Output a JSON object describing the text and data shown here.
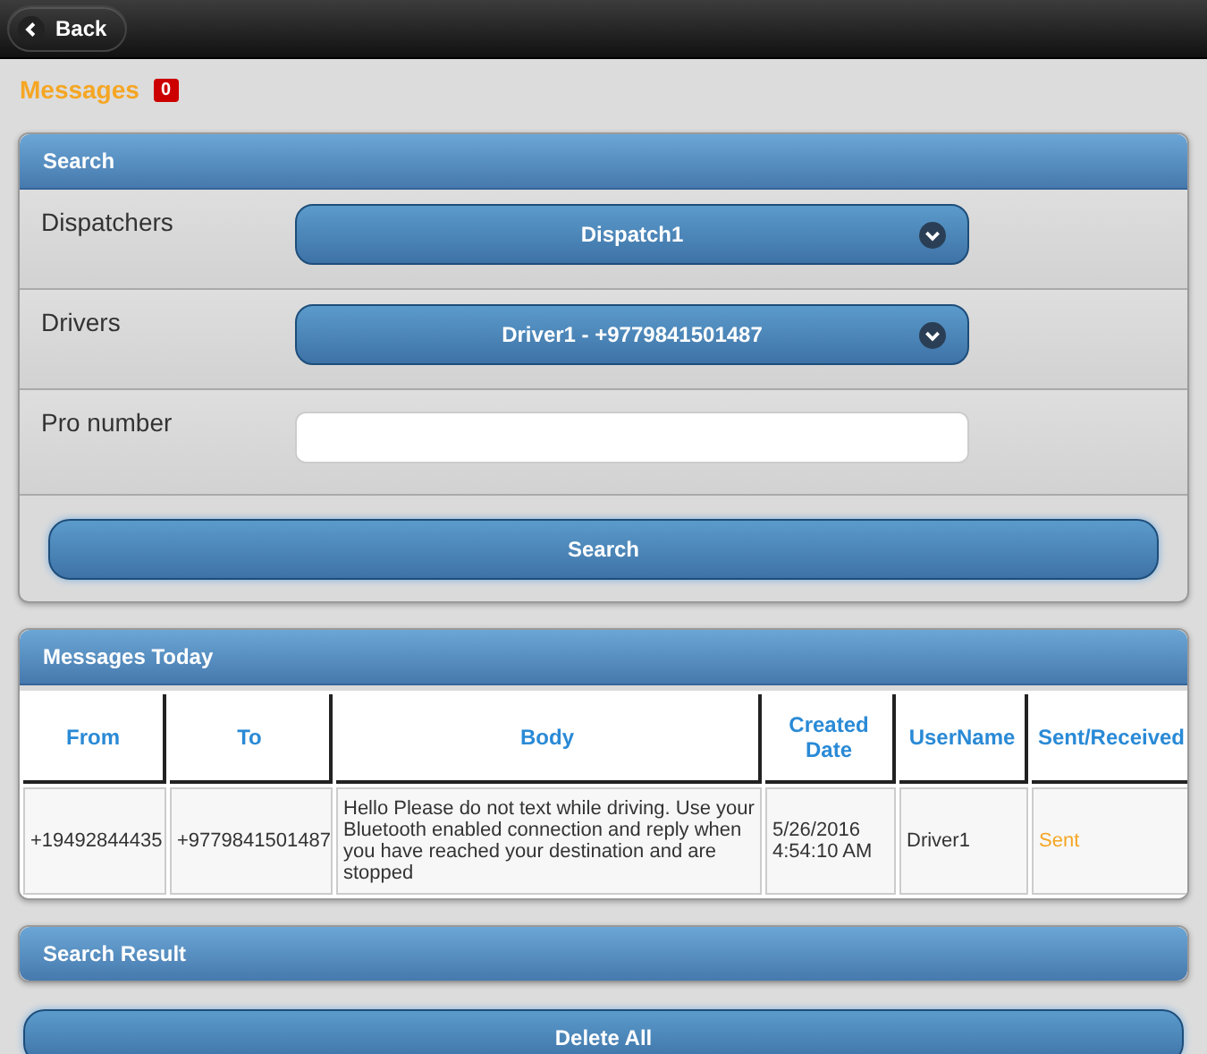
{
  "header": {
    "back_button": "Back"
  },
  "title": {
    "text": "Messages",
    "badge": "0"
  },
  "search_panel": {
    "title": "Search",
    "fields": [
      {
        "kind": "select",
        "label": "Dispatchers",
        "value": "Dispatch1"
      },
      {
        "kind": "select",
        "label": "Drivers",
        "value": "Driver1 - +9779841501487"
      },
      {
        "kind": "text",
        "label": "Pro number"
      }
    ],
    "button": "Search"
  },
  "messages_today": {
    "title": "Messages Today",
    "columns": [
      "From",
      "To",
      "Body",
      "Created Date",
      "UserName",
      "Sent/Received"
    ],
    "rows": [
      {
        "from": "+19492844435",
        "to": "+9779841501487",
        "body": "Hello Please do not text while driving. Use your Bluetooth enabled connection and reply when you have reached your destination and are stopped",
        "created_date": "5/26/2016 4:54:10 AM",
        "username": "Driver1",
        "status": "Sent"
      }
    ]
  },
  "search_result": {
    "title": "Search Result"
  },
  "delete_button": "Delete All"
}
